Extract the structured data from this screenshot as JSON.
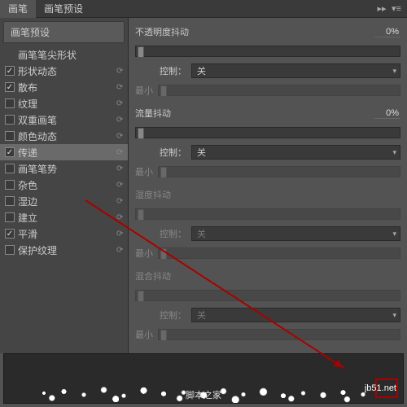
{
  "tabs": {
    "brush": "画笔",
    "preset": "画笔预设"
  },
  "sidebar": {
    "preset_btn": "画笔预设",
    "options": [
      {
        "label": "画笔笔尖形状",
        "check": "none"
      },
      {
        "label": "形状动态",
        "check": "on",
        "lock": true
      },
      {
        "label": "散布",
        "check": "on",
        "lock": true
      },
      {
        "label": "纹理",
        "check": "off",
        "lock": true
      },
      {
        "label": "双重画笔",
        "check": "off",
        "lock": true
      },
      {
        "label": "颜色动态",
        "check": "off",
        "lock": true
      },
      {
        "label": "传递",
        "check": "on",
        "lock": true,
        "selected": true
      },
      {
        "label": "画笔笔势",
        "check": "off",
        "lock": true
      },
      {
        "label": "杂色",
        "check": "off",
        "lock": true
      },
      {
        "label": "湿边",
        "check": "off",
        "lock": true
      },
      {
        "label": "建立",
        "check": "off",
        "lock": true
      },
      {
        "label": "平滑",
        "check": "on",
        "lock": true
      },
      {
        "label": "保护纹理",
        "check": "off",
        "lock": true
      }
    ]
  },
  "content": {
    "opacity_jitter": {
      "label": "不透明度抖动",
      "value": "0%"
    },
    "control": {
      "label": "控制：",
      "value": "关"
    },
    "min": "最小",
    "flow_jitter": {
      "label": "流量抖动",
      "value": "0%"
    },
    "wet_jitter": "湿度抖动",
    "mix_jitter": "混合抖动"
  },
  "footer": {
    "watermark": "jb51.net",
    "source": "脚本之家"
  }
}
